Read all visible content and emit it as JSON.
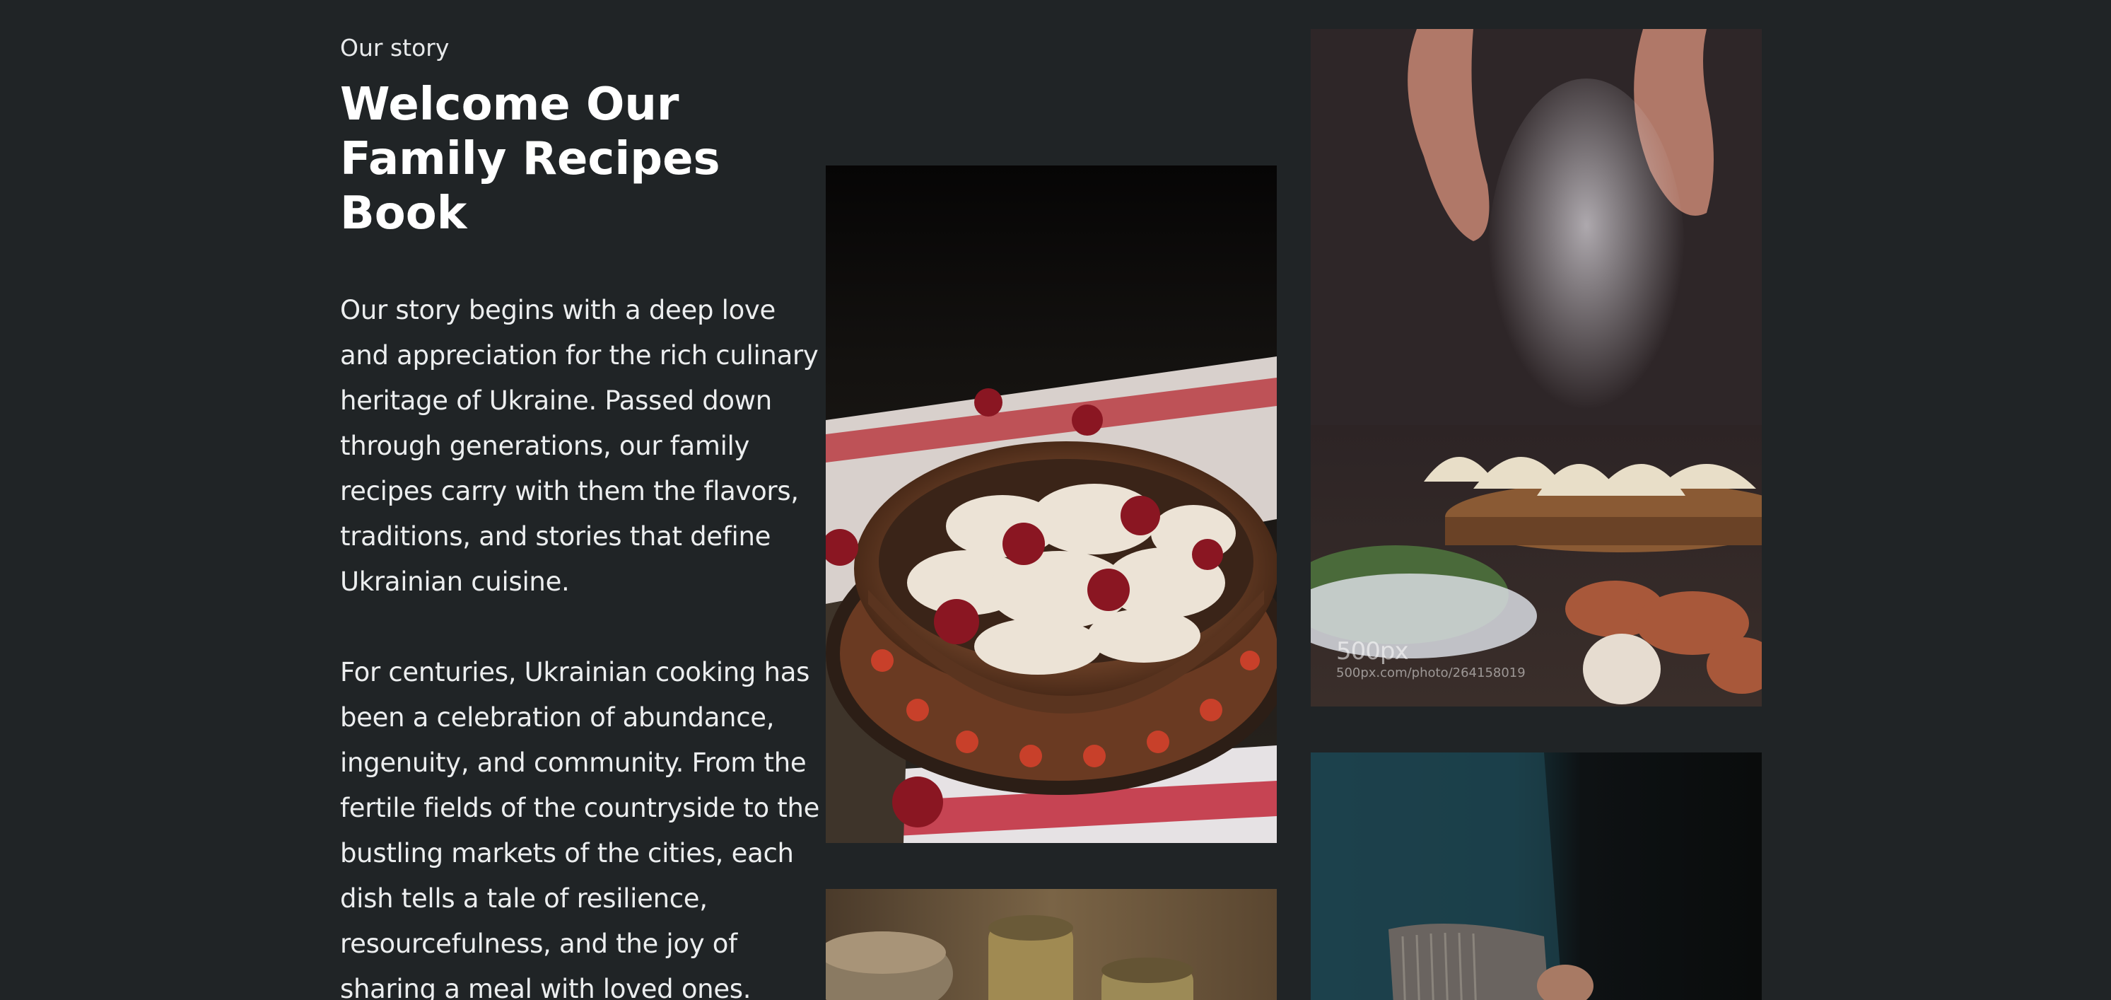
{
  "story": {
    "eyebrow": "Our story",
    "title_lines": [
      "Welcome Our",
      "Family Recipes",
      "Book"
    ],
    "paragraph_1": "Our story begins with a deep love and appreciation for the rich culinary heritage of Ukraine. Passed down through generations, our family recipes carry with them the flavors, traditions, and stories that define Ukrainian cuisine.",
    "paragraph_2": "For centuries, Ukrainian cooking has been a celebration of abundance, ingenuity, and community. From the fertile fields of the countryside to the bustling markets of the cities, each dish tells a tale of resilience, resourcefulness, and the joy of sharing a meal with loved ones."
  },
  "gallery": {
    "photo_dumplings": {
      "icon": "photo-varenyky-cherries"
    },
    "photo_flour": {
      "icon": "photo-hands-flour-dumplings",
      "watermark_logo": "500px",
      "watermark_url": "500px.com/photo/264158019"
    },
    "photo_mugs": {
      "icon": "photo-ceramic-mugs"
    },
    "photo_apron": {
      "icon": "photo-person-apron"
    }
  },
  "colors": {
    "background": "#202426",
    "text": "#ffffff"
  }
}
